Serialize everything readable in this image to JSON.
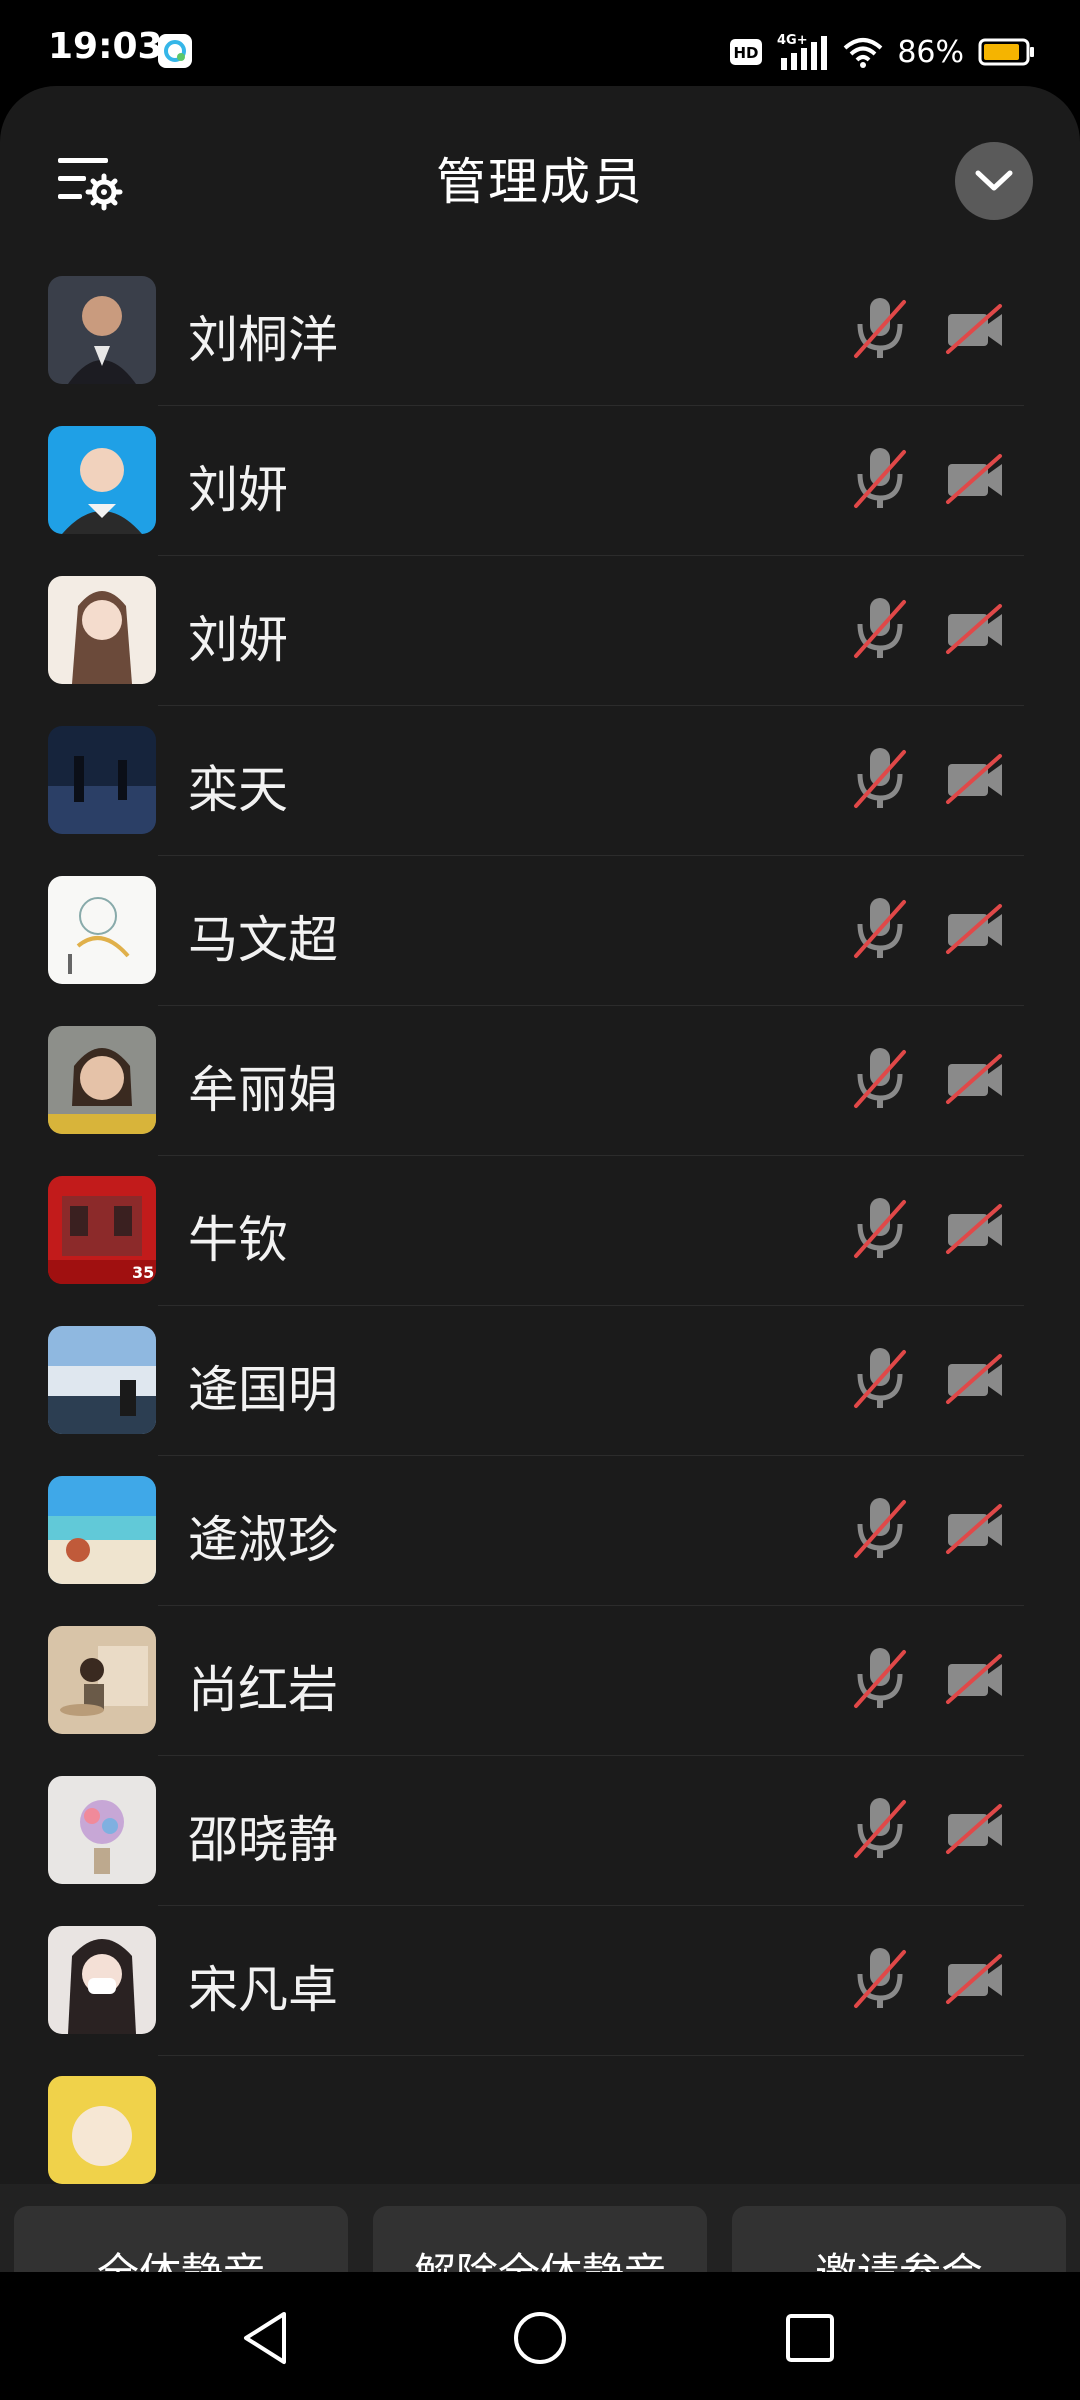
{
  "status_bar": {
    "time": "19:03",
    "network": "4G+",
    "hd": "HD",
    "battery": "86%",
    "battery_color": "#f5b400"
  },
  "header": {
    "title": "管理成员",
    "settings_icon": "list-settings-icon",
    "collapse_icon": "chevron-down-icon"
  },
  "members": [
    {
      "name": "刘桐洋",
      "mic": "muted",
      "camera": "off"
    },
    {
      "name": "刘妍",
      "mic": "muted",
      "camera": "off"
    },
    {
      "name": "刘妍",
      "mic": "muted",
      "camera": "off"
    },
    {
      "name": "栾天",
      "mic": "muted",
      "camera": "off"
    },
    {
      "name": "马文超",
      "mic": "muted",
      "camera": "off"
    },
    {
      "name": "牟丽娟",
      "mic": "muted",
      "camera": "off"
    },
    {
      "name": "牛钦",
      "mic": "muted",
      "camera": "off"
    },
    {
      "name": "逄国明",
      "mic": "muted",
      "camera": "off"
    },
    {
      "name": "逄淑珍",
      "mic": "muted",
      "camera": "off"
    },
    {
      "name": "尚红岩",
      "mic": "muted",
      "camera": "off"
    },
    {
      "name": "邵晓静",
      "mic": "muted",
      "camera": "off"
    },
    {
      "name": "宋凡卓",
      "mic": "muted",
      "camera": "off"
    }
  ],
  "actions": {
    "mute_all": "全体静音",
    "unmute_all": "解除全体静音",
    "invite": "邀请参会"
  },
  "colors": {
    "muted_slash": "#e04848",
    "icon_gray": "#8a8a8a"
  }
}
